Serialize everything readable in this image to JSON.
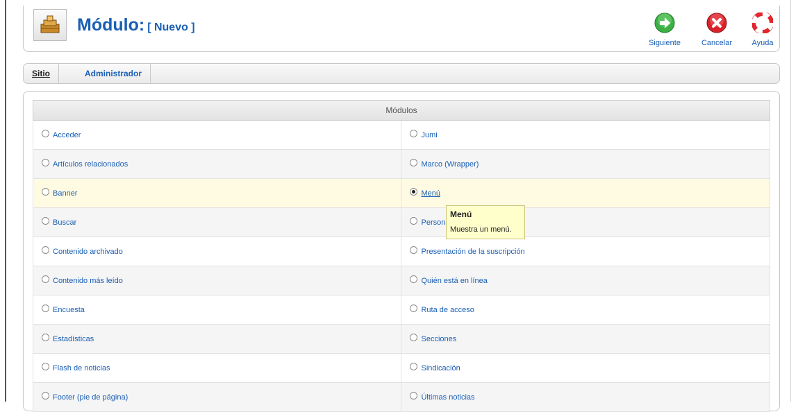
{
  "header": {
    "title": "Módulo:",
    "subtitle": "[ Nuevo ]",
    "icon": "module-manager-icon"
  },
  "toolbar": {
    "next_label": "Siguiente",
    "cancel_label": "Cancelar",
    "help_label": "Ayuda"
  },
  "tabs": [
    {
      "label": "Sitio",
      "active": true
    },
    {
      "label": "Administrador",
      "active": false
    }
  ],
  "modules": {
    "header": "Módulos",
    "rows": [
      {
        "left": "Acceder",
        "right": "Jumi"
      },
      {
        "left": "Artículos relacionados",
        "right": "Marco (Wrapper)"
      },
      {
        "left": "Banner",
        "right": "Menú"
      },
      {
        "left": "Buscar",
        "right": "Personalizado"
      },
      {
        "left": "Contenido archivado",
        "right": "Presentación de la suscripción"
      },
      {
        "left": "Contenido más leído",
        "right": "Quién está en línea"
      },
      {
        "left": "Encuesta",
        "right": "Ruta de acceso"
      },
      {
        "left": "Estadísticas",
        "right": "Secciones"
      },
      {
        "left": "Flash de noticias",
        "right": "Sindicación"
      },
      {
        "left": "Footer (pie de página)",
        "right": "Últimas noticias"
      }
    ],
    "selected": "Menú"
  },
  "tooltip": {
    "title": "Menú",
    "body": "Muestra un menú."
  },
  "colors": {
    "link": "#1a5fb4",
    "highlight_row": "#fffbe3",
    "tooltip_bg": "#ffffcc",
    "next_green": "#3cb043",
    "cancel_red": "#d8232a",
    "help_red": "#e4252b"
  }
}
